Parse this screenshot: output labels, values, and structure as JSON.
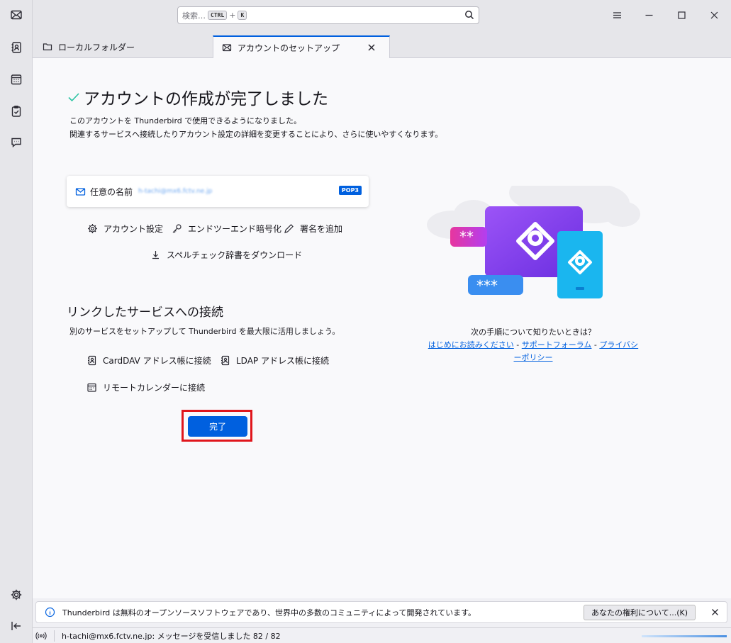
{
  "spaces": {
    "items": [
      {
        "name": "mail-icon"
      },
      {
        "name": "address-book-icon"
      },
      {
        "name": "calendar-icon"
      },
      {
        "name": "tasks-icon"
      },
      {
        "name": "chat-icon"
      }
    ],
    "settings_icon": "gear-icon",
    "collapse_icon": "collapse-icon"
  },
  "search": {
    "placeholder": "検索…",
    "shortcut_key1": "CTRL",
    "shortcut_plus": "+",
    "shortcut_key2": "K"
  },
  "tabs": [
    {
      "label": "ローカルフォルダー",
      "icon": "folder-icon",
      "active": false
    },
    {
      "label": "アカウントのセットアップ",
      "icon": "mail-setup-icon",
      "active": true
    }
  ],
  "main": {
    "title": "アカウントの作成が完了しました",
    "description_line1": "このアカウントを Thunderbird で使用できるようになりました。",
    "description_line2": "関連するサービスへ接続したりアカウント設定の詳細を変更することにより、さらに使いやすくなります。",
    "account": {
      "name": "任意の名前",
      "email": "h-tachi@mx6.fctv.ne.jp",
      "protocol": "POP3"
    },
    "actions": {
      "account_settings": "アカウント設定",
      "e2e": "エンドツーエンド暗号化",
      "signature": "署名を追加",
      "spellcheck": "スペルチェック辞書をダウンロード"
    },
    "linked_title": "リンクしたサービスへの接続",
    "linked_desc": "別のサービスをセットアップして Thunderbird を最大限に活用しましょう。",
    "linked": {
      "carddav": "CardDAV アドレス帳に接続",
      "ldap": "LDAP アドレス帳に接続",
      "calendar": "リモートカレンダーに接続"
    },
    "done_label": "完了",
    "help": {
      "question": "次の手順について知りたいときは？",
      "link1": "はじめにお読みください",
      "sep1": " - ",
      "link2": "サポートフォーラム",
      "sep2": " - ",
      "link3": "プライバシーポリシー"
    }
  },
  "notification": {
    "text": "Thunderbird は無料のオープンソースソフトウェアであり、世界中の多数のコミュニティによって開発されています。",
    "button": "あなたの権利について...(K)"
  },
  "status": {
    "text": "h-tachi@mx6.fctv.ne.jp: メッセージを受信しました 82 / 82"
  },
  "colors": {
    "accent": "#0060df",
    "success": "#2ac3a2",
    "highlight": "#e0161c"
  }
}
